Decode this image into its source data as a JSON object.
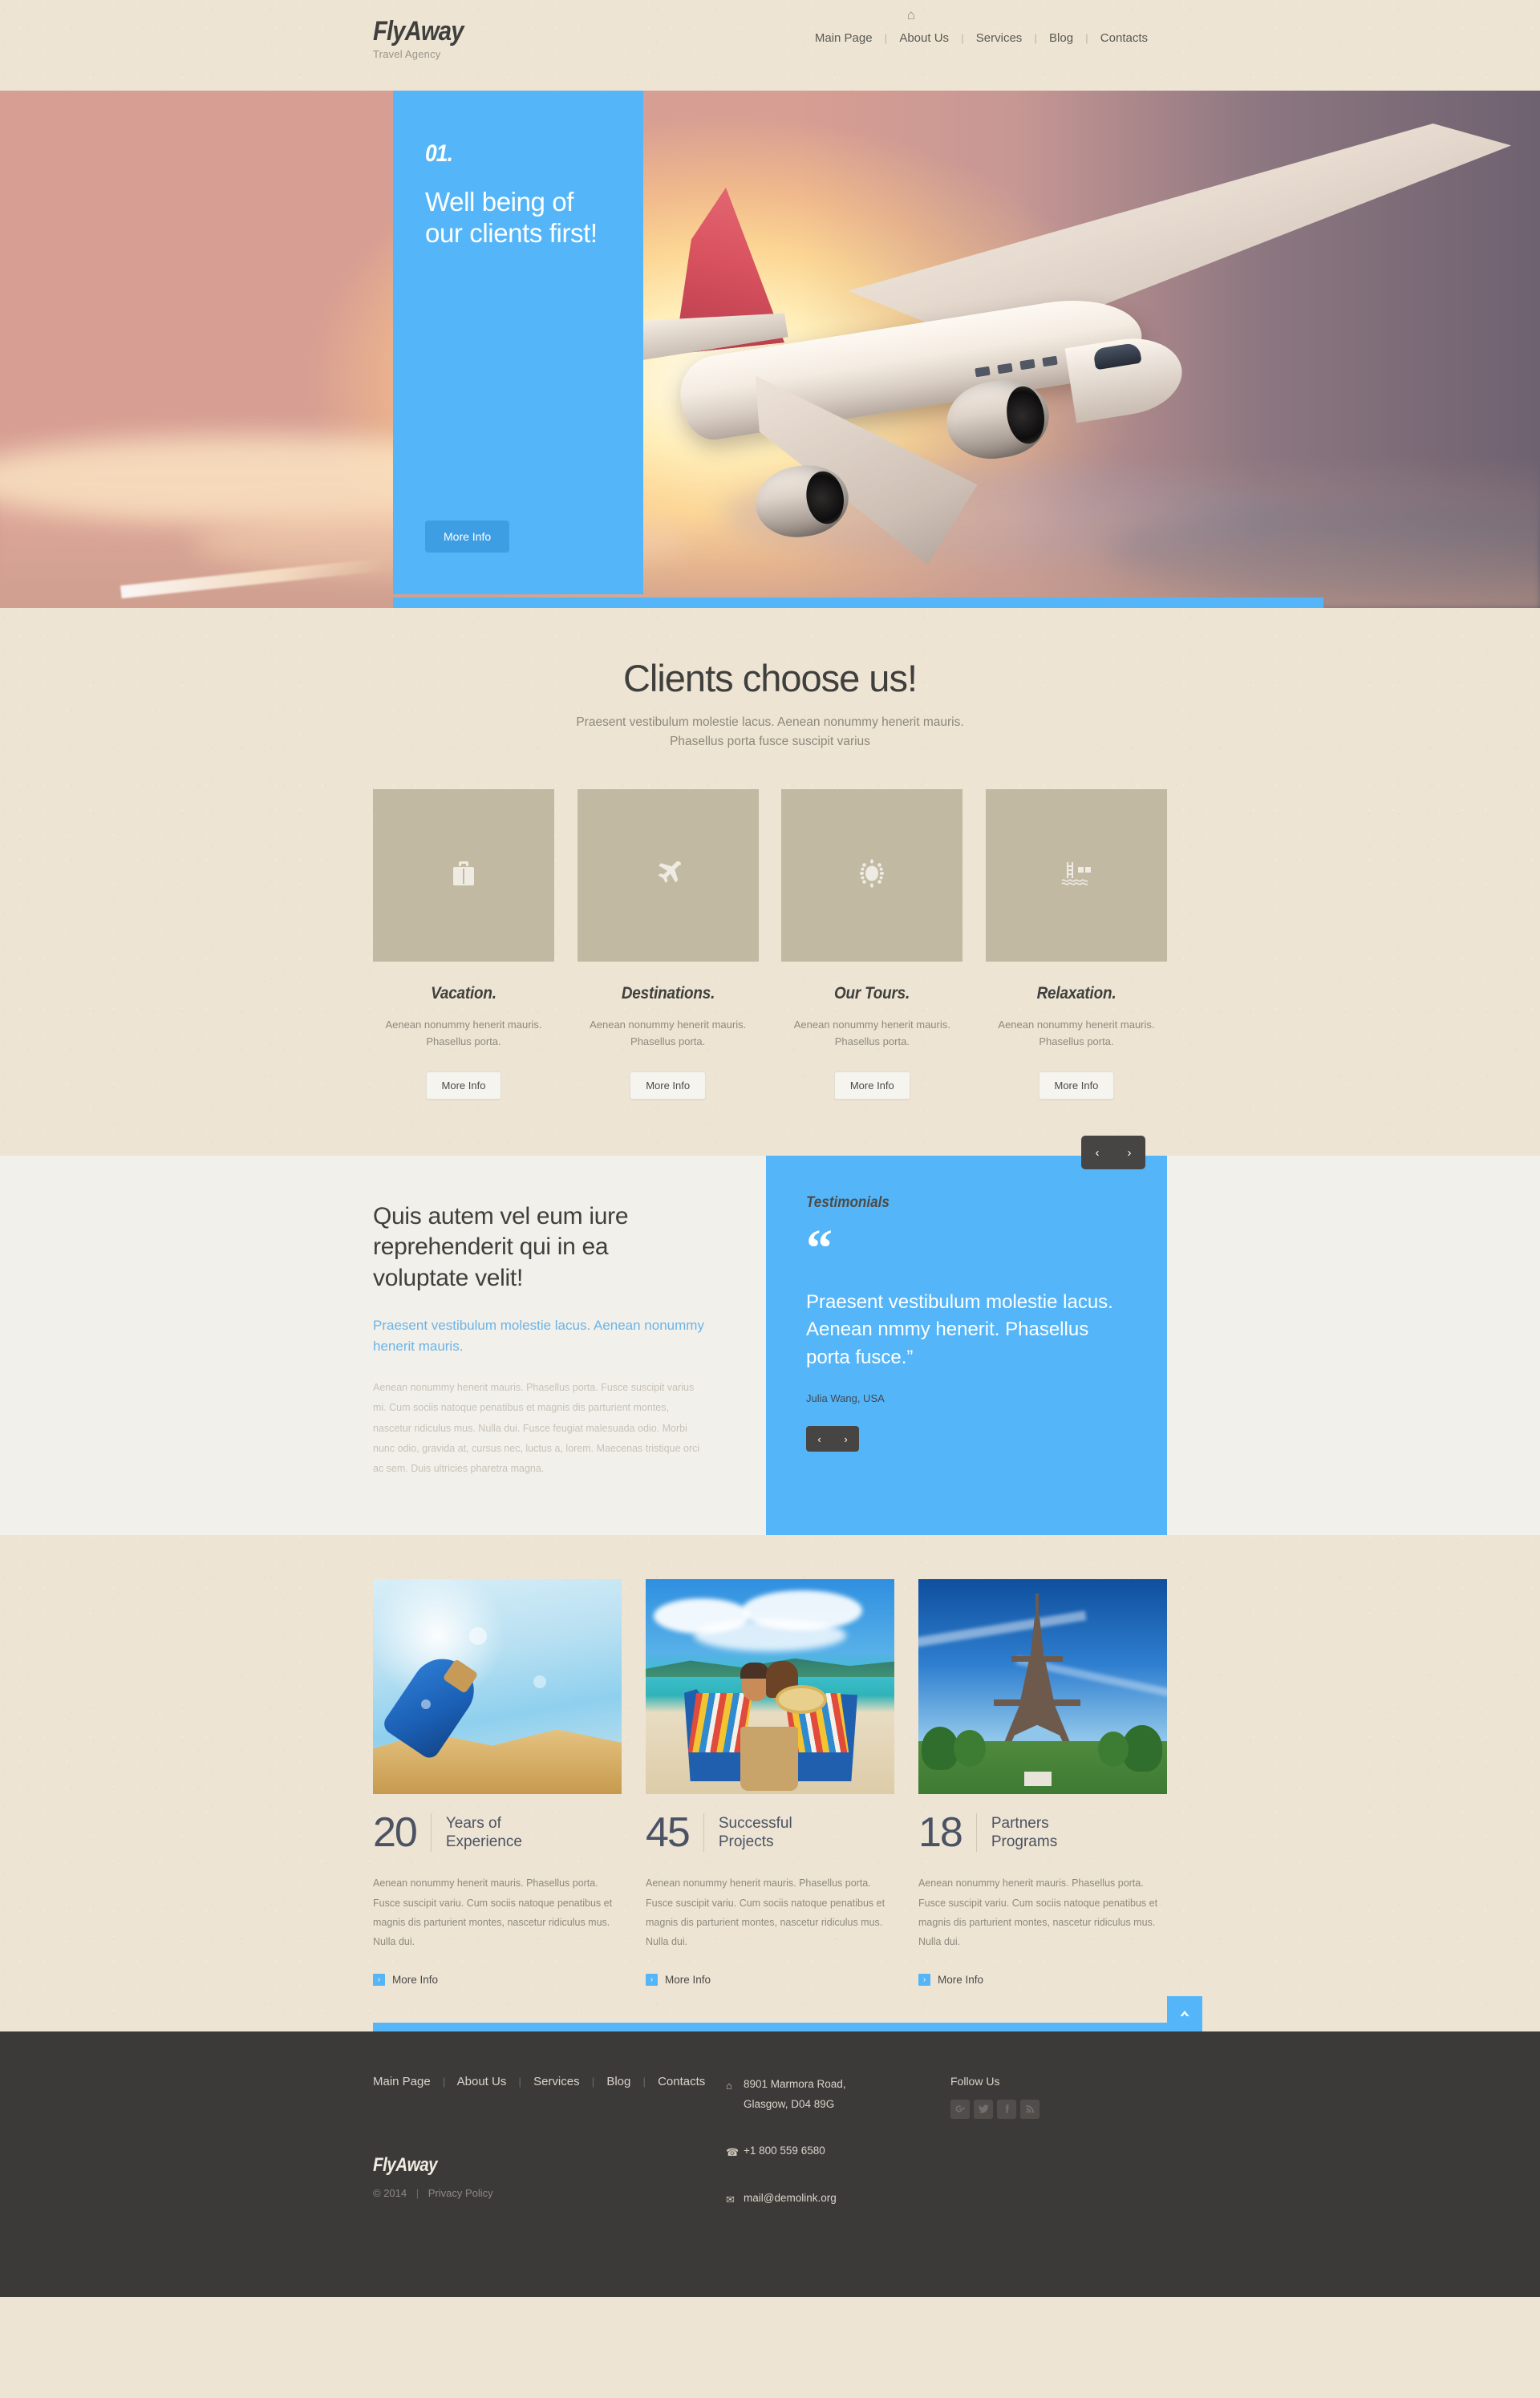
{
  "brand": {
    "name": "FlyAway",
    "tagline": "Travel Agency"
  },
  "colors": {
    "accent_blue": "#54B6F9",
    "page_bg": "#EDE4D3",
    "card_bg": "#C2B9A3",
    "about_bg": "#F2F0EA",
    "footer_bg": "#3C3A39",
    "dark_control": "#474543",
    "stat_number": "#4B5263"
  },
  "header": {
    "home_icon": "home-icon",
    "nav": [
      "Main Page",
      "About Us",
      "Services",
      "Blog",
      "Contacts"
    ],
    "separator": "|"
  },
  "hero": {
    "slide_number": "01.",
    "title": "Well being of our clients first!",
    "button": "More Info",
    "prev_icon": "‹",
    "next_icon": "›"
  },
  "clients": {
    "heading": "Clients choose us!",
    "lead_line1": "Praesent vestibulum molestie lacus. Aenean nonummy henerit mauris.",
    "lead_line2": "Phasellus porta fusce suscipit varius",
    "cards": [
      {
        "icon": "suitcase-icon",
        "title": "Vacation.",
        "text": "Aenean nonummy henerit mauris. Phasellus porta.",
        "button": "More Info"
      },
      {
        "icon": "airplane-icon",
        "title": "Destinations.",
        "text": "Aenean nonummy henerit mauris. Phasellus porta.",
        "button": "More Info"
      },
      {
        "icon": "sun-icon",
        "title": "Our Tours.",
        "text": "Aenean nonummy henerit mauris. Phasellus porta.",
        "button": "More Info"
      },
      {
        "icon": "pool-icon",
        "title": "Relaxation.",
        "text": "Aenean nonummy henerit mauris. Phasellus porta.",
        "button": "More Info"
      }
    ]
  },
  "about": {
    "heading": "Quis autem vel eum iure reprehenderit qui in ea voluptate velit!",
    "highlight": "Praesent vestibulum molestie lacus. Aenean nonummy henerit mauris.",
    "body": "Aenean nonummy henerit mauris. Phasellus porta. Fusce suscipit varius mi. Cum sociis natoque penatibus et magnis dis parturient montes, nascetur ridiculus mus. Nulla dui. Fusce feugiat malesuada odio. Morbi nunc odio, gravida at, cursus nec, luctus a, lorem. Maecenas tristique orci ac sem. Duis ultricies pharetra magna."
  },
  "testimonials": {
    "title": "Testimonials",
    "quote_glyph": "“",
    "text": "Praesent vestibulum molestie lacus. Aenean nmmy henerit. Phasellus porta fusce.”",
    "author": "Julia Wang, USA",
    "prev_icon": "‹",
    "next_icon": "›"
  },
  "stats": [
    {
      "photo": "message-in-a-bottle-photo",
      "number": "20",
      "label_line1": "Years of",
      "label_line2": "Experience",
      "text": "Aenean nonummy henerit mauris. Phasellus porta. Fusce suscipit variu. Cum sociis natoque penatibus et magnis dis parturient montes, nascetur ridiculus mus. Nulla dui.",
      "link": "More Info",
      "link_icon": "›"
    },
    {
      "photo": "beach-couple-photo",
      "number": "45",
      "label_line1": "Successful",
      "label_line2": "Projects",
      "text": "Aenean nonummy henerit mauris. Phasellus porta. Fusce suscipit variu. Cum sociis natoque penatibus et magnis dis parturient montes, nascetur ridiculus mus. Nulla dui.",
      "link": "More Info",
      "link_icon": "›"
    },
    {
      "photo": "eiffel-tower-photo",
      "number": "18",
      "label_line1": "Partners",
      "label_line2": "Programs",
      "text": "Aenean nonummy henerit mauris. Phasellus porta. Fusce suscipit variu. Cum sociis natoque penatibus et magnis dis parturient montes, nascetur ridiculus mus. Nulla dui.",
      "link": "More Info",
      "link_icon": "›"
    }
  ],
  "to_top": {
    "icon": "▲",
    "name": "scroll-to-top"
  },
  "footer": {
    "nav": [
      "Main Page",
      "About Us",
      "Services",
      "Blog",
      "Contacts"
    ],
    "separator": "|",
    "brand": "FlyAway",
    "copyright": "© 2014",
    "privacy": "Privacy Policy",
    "address_line1": "8901 Marmora Road,",
    "address_line2": "Glasgow, D04 89G",
    "phone": "+1 800 559 6580",
    "email": "mail@demolink.org",
    "follow_label": "Follow Us",
    "socials": [
      "google-plus-icon",
      "twitter-icon",
      "facebook-icon",
      "rss-icon"
    ]
  }
}
